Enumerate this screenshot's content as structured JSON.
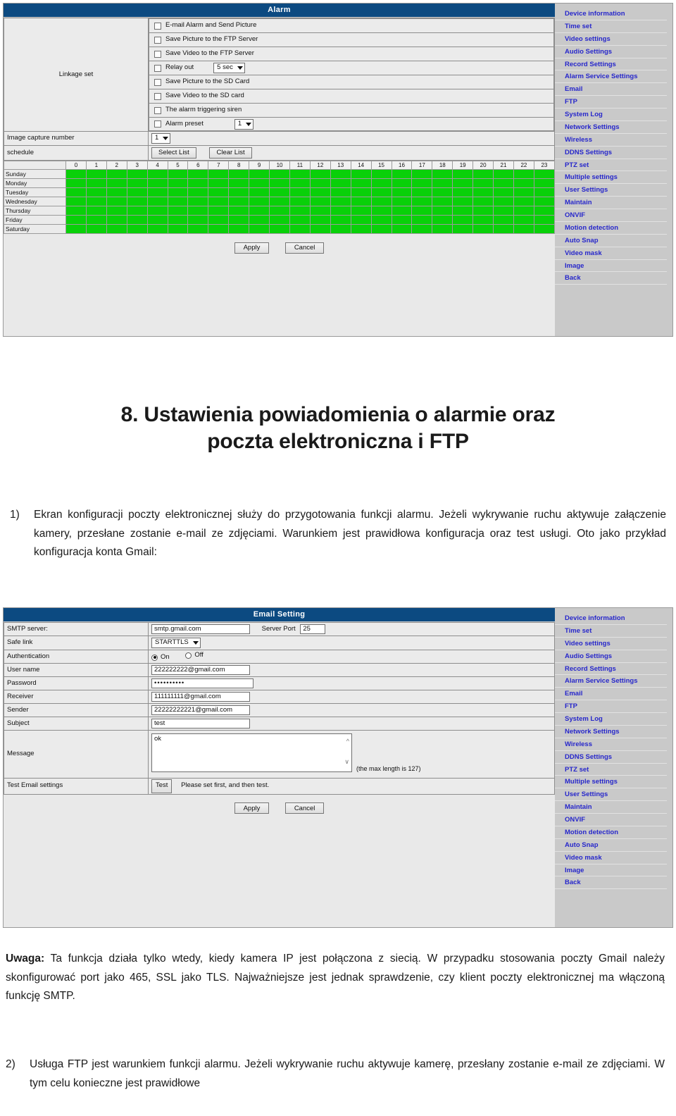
{
  "document": {
    "heading": "8. Ustawienia powiadomienia o alarmie oraz poczta elektroniczna i FTP",
    "heading_line1": "8. Ustawienia powiadomienia o alarmie oraz",
    "heading_line2": "poczta elektroniczna i FTP",
    "item1_number": "1)",
    "item1_text": "Ekran konfiguracji poczty elektronicznej służy do przygotowania funkcji alarmu. Jeżeli wykrywanie ruchu aktywuje załączenie kamery, przesłane zostanie e-mail ze zdjęciami. Warunkiem jest prawidłowa konfiguracja oraz test usługi. Oto jako przykład konfiguracja konta Gmail:",
    "note_label": "Uwaga:",
    "note_text": " Ta funkcja działa tylko wtedy, kiedy kamera IP jest połączona z siecią. W przypadku stosowania poczty Gmail należy skonfigurować port jako 465, SSL jako TLS. Najważniejsze jest jednak sprawdzenie, czy klient poczty elektronicznej ma włączoną funkcję SMTP.",
    "item2_number": "2)",
    "item2_text": "Usługa FTP jest warunkiem funkcji alarmu. Jeżeli wykrywanie ruchu aktywuje kamerę, przesłany zostanie e-mail ze zdjęciami. W tym celu konieczne jest prawidłowe"
  },
  "alarm_screen": {
    "title": "Alarm",
    "linkage_label": "Linkage set",
    "checkboxes": [
      {
        "label": "E-mail Alarm and Send Picture",
        "checked": false,
        "control": null
      },
      {
        "label": "Save Picture to the FTP Server",
        "checked": false,
        "control": null
      },
      {
        "label": "Save Video to the FTP Server",
        "checked": false,
        "control": null
      },
      {
        "label": "Relay out",
        "checked": false,
        "control": "5 sec"
      },
      {
        "label": "Save Picture to the SD Card",
        "checked": false,
        "control": null
      },
      {
        "label": "Save Video to the SD card",
        "checked": false,
        "control": null
      },
      {
        "label": "The alarm triggering siren",
        "checked": false,
        "control": null
      },
      {
        "label": "Alarm preset",
        "checked": false,
        "control": "1"
      }
    ],
    "image_capture_label": "Image capture number",
    "image_capture_value": "1",
    "schedule_label": "schedule",
    "select_list_label": "Select List",
    "clear_list_label": "Clear List",
    "hours": [
      "0",
      "1",
      "2",
      "3",
      "4",
      "5",
      "6",
      "7",
      "8",
      "9",
      "10",
      "11",
      "12",
      "13",
      "14",
      "15",
      "16",
      "17",
      "18",
      "19",
      "20",
      "21",
      "22",
      "23"
    ],
    "days": [
      "Sunday",
      "Monday",
      "Tuesday",
      "Wednesday",
      "Thursday",
      "Friday",
      "Saturday"
    ],
    "cell_color": "#0ccf0c",
    "apply_label": "Apply",
    "cancel_label": "Cancel"
  },
  "email_screen": {
    "title": "Email Setting",
    "rows": {
      "smtp_label": "SMTP server:",
      "smtp_value": "smtp.gmail.com",
      "server_port_label": "Server Port",
      "server_port_value": "25",
      "safe_link_label": "Safe link",
      "safe_link_value": "STARTTLS",
      "auth_label": "Authentication",
      "auth_on": "On",
      "auth_off": "Off",
      "auth_selected": "On",
      "username_label": "User name",
      "username_value": "222222222@gmail.com",
      "password_label": "Password",
      "password_value": "••••••••••",
      "receiver_label": "Receiver",
      "receiver_value": "111111111@gmail.com",
      "sender_label": "Sender",
      "sender_value": "22222222221@gmail.com",
      "subject_label": "Subject",
      "subject_value": "test",
      "message_label": "Message",
      "message_value": "ok",
      "message_hint": "(the max length is 127)",
      "test_label": "Test Email settings",
      "test_button": "Test",
      "test_hint": "Please set first, and then test."
    },
    "apply_label": "Apply",
    "cancel_label": "Cancel"
  },
  "sidebar": {
    "items": [
      "Device information",
      "Time set",
      "Video settings",
      "Audio Settings",
      "Record Settings",
      "Alarm Service Settings",
      "Email",
      "FTP",
      "System Log",
      "Network Settings",
      "Wireless",
      "DDNS Settings",
      "PTZ set",
      "Multiple settings",
      "User Settings",
      "Maintain",
      "ONVIF",
      "Motion detection",
      "Auto Snap",
      "Video mask",
      "Image",
      "Back"
    ]
  },
  "colors": {
    "titlebar_blue": "#0d4a80",
    "schedule_green": "#0ccf0c",
    "menu_text_blue": "#2727c8",
    "menu_bg": "#c9c9c9",
    "panel_bg": "#ebebeb"
  }
}
